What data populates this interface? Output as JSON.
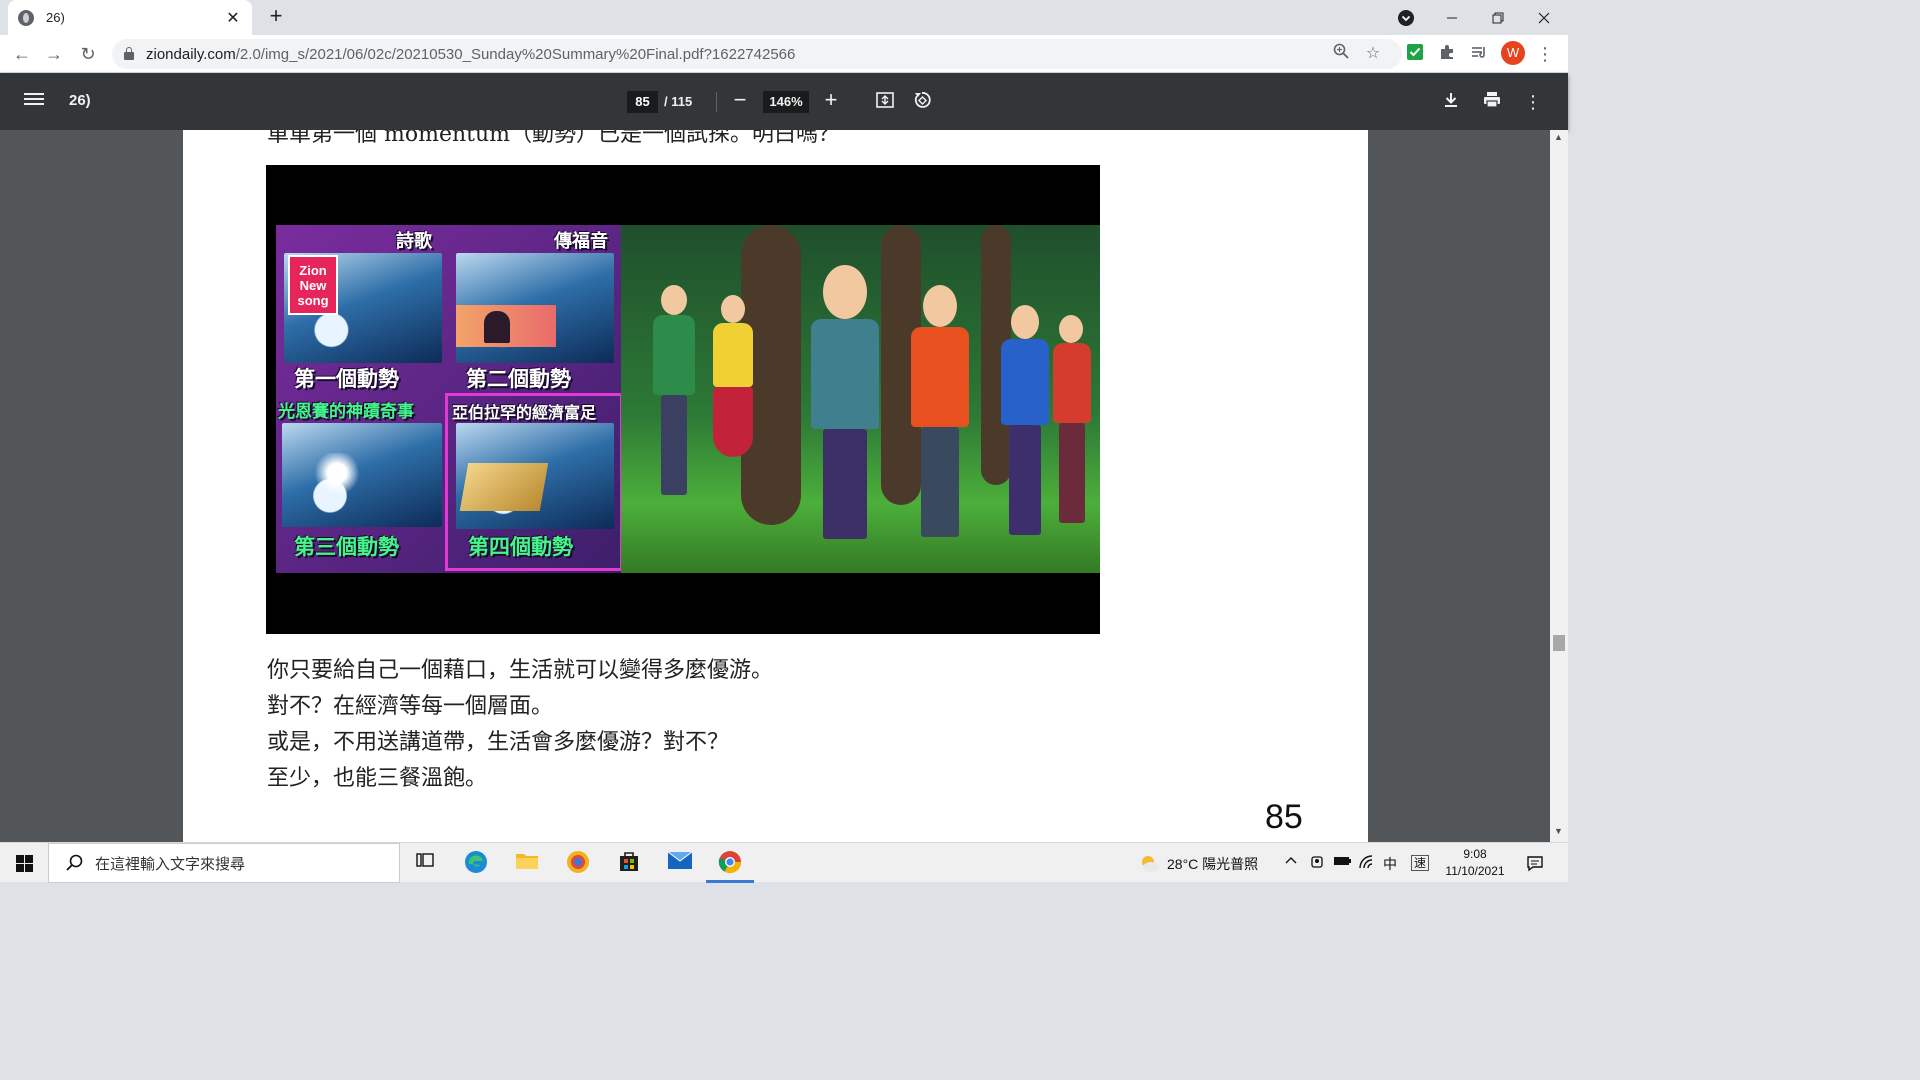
{
  "browser": {
    "tab_title": "26)",
    "url_domain": "ziondaily.com",
    "url_rest": "/2.0/img_s/2021/06/02c/20210530_Sunday%20Summary%20Final.pdf?1622742566",
    "profile_initial": "W"
  },
  "pdf": {
    "doc_title": "26)",
    "current_page": "85",
    "total_pages": "/ 115",
    "zoom": "146%"
  },
  "document": {
    "prev_line": "單單第一個 momentum（動勢）已是一個試探。明白嗎？",
    "figure": {
      "tile1_title": "詩歌",
      "tile2_title": "傳福音",
      "logo_text": "Zion New song",
      "label1": "第一個動勢",
      "label2": "第二個動勢",
      "caption3": "光恩賽的神蹟奇事",
      "caption4": "亞伯拉罕的經濟富足",
      "label3": "第三個動勢",
      "label4": "第四個動勢"
    },
    "paragraphs": [
      "你只要給自己一個藉口，生活就可以變得多麼優游。",
      "對不？在經濟等每一個層面。",
      "或是，不用送講道帶，生活會多麼優游？對不？",
      "至少，也能三餐溫飽。"
    ],
    "page_number": "85"
  },
  "taskbar": {
    "search_placeholder": "在這裡輸入文字來搜尋",
    "weather": "28°C 陽光普照",
    "ime_lang": "中",
    "ime_mode": "速",
    "time": "9:08",
    "date": "11/10/2021"
  }
}
